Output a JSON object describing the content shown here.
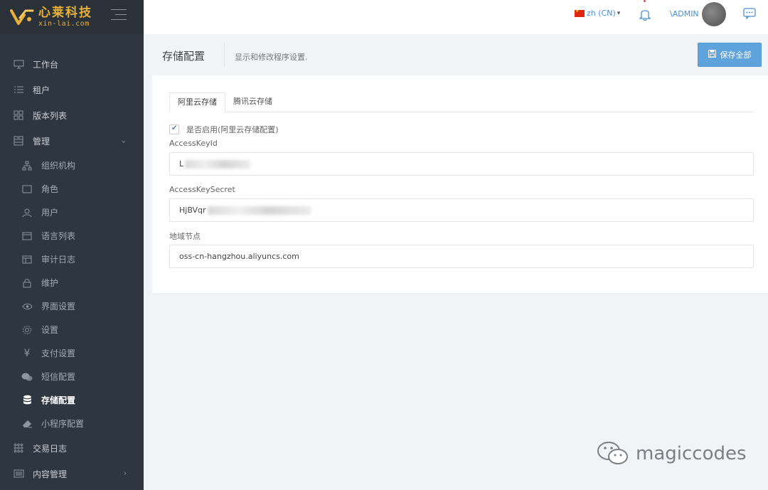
{
  "brand": {
    "name_cn": "心莱科技",
    "name_en": "xin-lai.com"
  },
  "sidebar": {
    "items": [
      {
        "label": "工作台",
        "icon": "monitor-icon"
      },
      {
        "label": "租户",
        "icon": "list-icon"
      },
      {
        "label": "版本列表",
        "icon": "grid-icon"
      },
      {
        "label": "管理",
        "icon": "cabinet-icon",
        "expanded": true
      },
      {
        "label": "组织机构",
        "icon": "org-icon",
        "sub": true
      },
      {
        "label": "角色",
        "icon": "square-icon",
        "sub": true
      },
      {
        "label": "用户",
        "icon": "user-icon",
        "sub": true
      },
      {
        "label": "语言列表",
        "icon": "window-icon",
        "sub": true
      },
      {
        "label": "审计日志",
        "icon": "window-icon",
        "sub": true
      },
      {
        "label": "维护",
        "icon": "lock-icon",
        "sub": true
      },
      {
        "label": "界面设置",
        "icon": "eye-icon",
        "sub": true
      },
      {
        "label": "设置",
        "icon": "gear-icon",
        "sub": true
      },
      {
        "label": "支付设置",
        "icon": "yen-icon",
        "sub": true
      },
      {
        "label": "短信配置",
        "icon": "comments-icon",
        "sub": true
      },
      {
        "label": "存储配置",
        "icon": "database-icon",
        "sub": true,
        "active": true
      },
      {
        "label": "小程序配置",
        "icon": "eraser-icon",
        "sub": true
      },
      {
        "label": "交易日志",
        "icon": "dots-icon"
      },
      {
        "label": "内容管理",
        "icon": "list-box-icon"
      }
    ]
  },
  "topbar": {
    "language": "zh (CN)",
    "user": "\\ADMIN"
  },
  "page": {
    "title": "存储配置",
    "description": "显示和修改程序设置.",
    "save_all_label": "保存全部"
  },
  "tabs": [
    "阿里云存储",
    "腾讯云存储"
  ],
  "form": {
    "enable_label": "是否启用(阿里云存储配置)",
    "enable_checked": true,
    "access_key_id_label": "AccessKeyId",
    "access_key_id_value": "L",
    "access_key_secret_label": "AccessKeySecret",
    "access_key_secret_value": "HjBVqr",
    "region_label": "地域节点",
    "region_value": "oss-cn-hangzhou.aliyuncs.com"
  },
  "watermark": {
    "text": "magiccodes"
  },
  "colors": {
    "sidebar_bg": "#2e3640",
    "accent": "#5fa3dc",
    "brand_gold": "#e8b23a"
  }
}
